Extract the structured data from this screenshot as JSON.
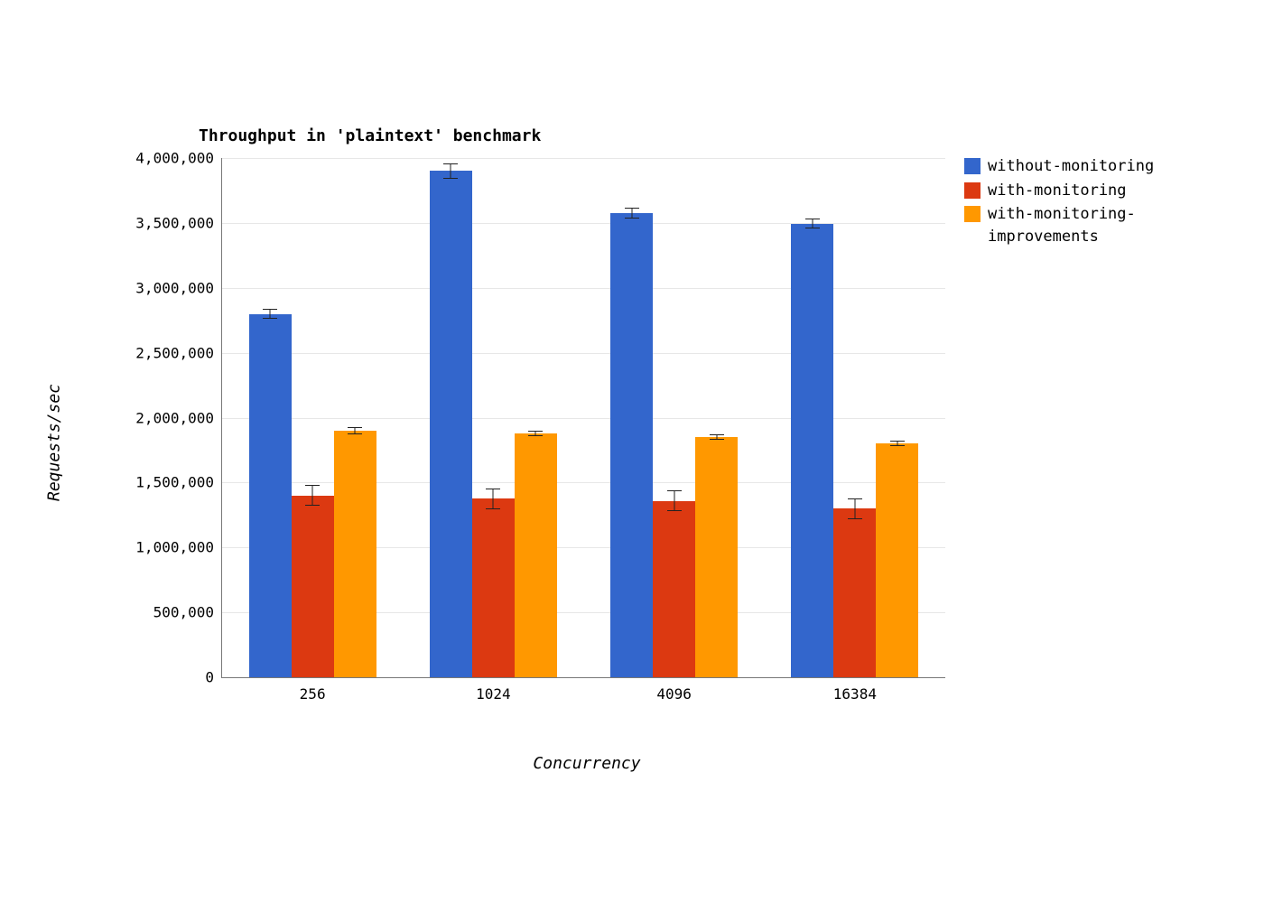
{
  "chart_data": {
    "type": "bar",
    "title": "Throughput in 'plaintext' benchmark",
    "xlabel": "Concurrency",
    "ylabel": "Requests/sec",
    "ylim": [
      0,
      4000000
    ],
    "ytick_interval": 500000,
    "categories": [
      "256",
      "1024",
      "4096",
      "16384"
    ],
    "series": [
      {
        "name": "without-monitoring",
        "color": "#3366cc",
        "values": [
          2800000,
          3900000,
          3575000,
          3495000
        ],
        "errors": [
          40000,
          60000,
          40000,
          40000
        ]
      },
      {
        "name": "with-monitoring",
        "color": "#dc3911",
        "values": [
          1400000,
          1375000,
          1360000,
          1300000
        ],
        "errors": [
          80000,
          80000,
          80000,
          80000
        ]
      },
      {
        "name": "with-monitoring-improvements",
        "color": "#ff9800",
        "values": [
          1900000,
          1880000,
          1850000,
          1800000
        ],
        "errors": [
          30000,
          20000,
          20000,
          20000
        ]
      }
    ],
    "legend_position": "right",
    "grid": "horizontal"
  },
  "legend_wrap": {
    "with-monitoring-improvements": [
      "with-monitoring-",
      "improvements"
    ]
  }
}
